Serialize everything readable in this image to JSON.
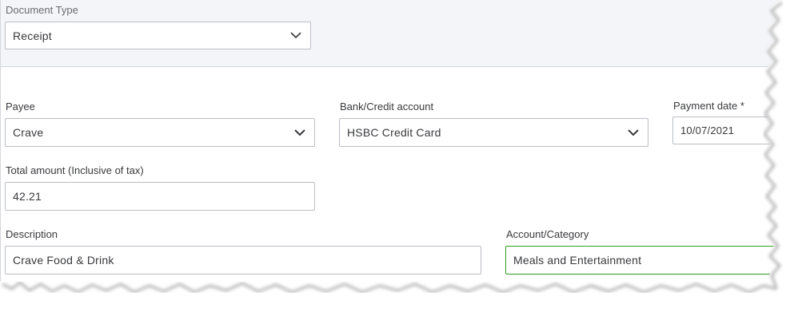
{
  "document_type": {
    "label": "Document Type",
    "value": "Receipt"
  },
  "payee": {
    "label": "Payee",
    "value": "Crave"
  },
  "bank_account": {
    "label": "Bank/Credit account",
    "value": "HSBC Credit Card"
  },
  "payment_date": {
    "label": "Payment date *",
    "value": "10/07/2021"
  },
  "total_amount": {
    "label": "Total amount (Inclusive of tax)",
    "value": "42.21"
  },
  "description": {
    "label": "Description",
    "value": "Crave Food & Drink"
  },
  "account_category": {
    "label": "Account/Category",
    "value": "Meals and Entertainment"
  },
  "colors": {
    "focus_border": "#2ca01c",
    "field_border": "#babec5",
    "band": "#f4f5f8",
    "text": "#393a3d"
  },
  "icons": [
    "chevron-down-icon"
  ]
}
